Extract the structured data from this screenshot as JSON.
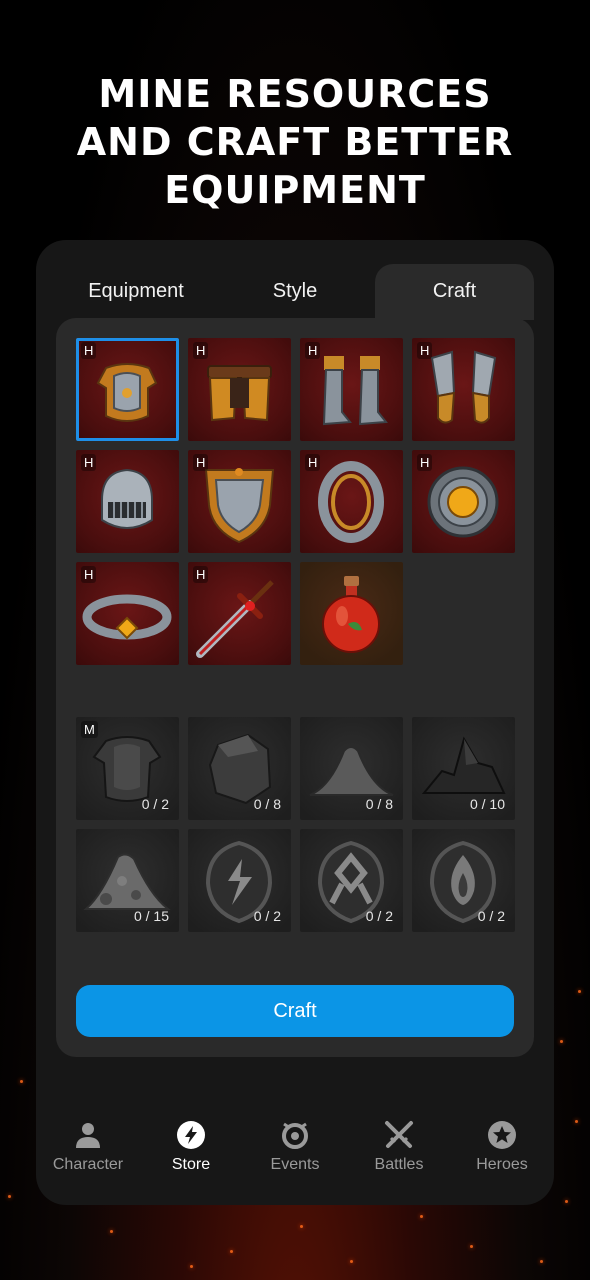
{
  "headline": {
    "line1": "MINE RESOURCES",
    "line2": "AND CRAFT BETTER",
    "line3": "EQUIPMENT"
  },
  "tabs": [
    {
      "label": "Equipment",
      "active": false
    },
    {
      "label": "Style",
      "active": false
    },
    {
      "label": "Craft",
      "active": true
    }
  ],
  "equipment_items": [
    {
      "name": "armor-chestplate",
      "badge": "H",
      "selected": true
    },
    {
      "name": "armor-leg-plates",
      "badge": "H"
    },
    {
      "name": "armor-boots",
      "badge": "H"
    },
    {
      "name": "armor-gauntlets",
      "badge": "H"
    },
    {
      "name": "knight-helmet",
      "badge": "H"
    },
    {
      "name": "shield",
      "badge": "H"
    },
    {
      "name": "ring",
      "badge": "H"
    },
    {
      "name": "amulet",
      "badge": "H"
    },
    {
      "name": "bracelet",
      "badge": "H"
    },
    {
      "name": "sword",
      "badge": "H"
    },
    {
      "name": "health-potion",
      "badge": ""
    }
  ],
  "resources": [
    {
      "name": "dark-armor",
      "badge": "M",
      "count": "0 / 2"
    },
    {
      "name": "stone-chunk",
      "badge": "",
      "count": "0 / 8"
    },
    {
      "name": "sand-pile",
      "badge": "",
      "count": "0 / 8"
    },
    {
      "name": "coal-pile",
      "badge": "",
      "count": "0 / 10"
    },
    {
      "name": "ore-pile",
      "badge": "",
      "count": "0 / 15"
    },
    {
      "name": "lightning-rune",
      "badge": "",
      "count": "0 / 2"
    },
    {
      "name": "othala-rune",
      "badge": "",
      "count": "0 / 2"
    },
    {
      "name": "fire-rune",
      "badge": "",
      "count": "0 / 2"
    }
  ],
  "craft_button": "Craft",
  "nav": [
    {
      "label": "Character",
      "icon": "person-icon",
      "active": false
    },
    {
      "label": "Store",
      "icon": "lightning-icon",
      "active": true
    },
    {
      "label": "Events",
      "icon": "events-icon",
      "active": false
    },
    {
      "label": "Battles",
      "icon": "crossed-swords-icon",
      "active": false
    },
    {
      "label": "Heroes",
      "icon": "star-icon",
      "active": false
    }
  ],
  "colors": {
    "accent": "#0b95e6",
    "selected_outline": "#1e8fe8",
    "panel": "#2a2a2a",
    "card": "#171717"
  }
}
